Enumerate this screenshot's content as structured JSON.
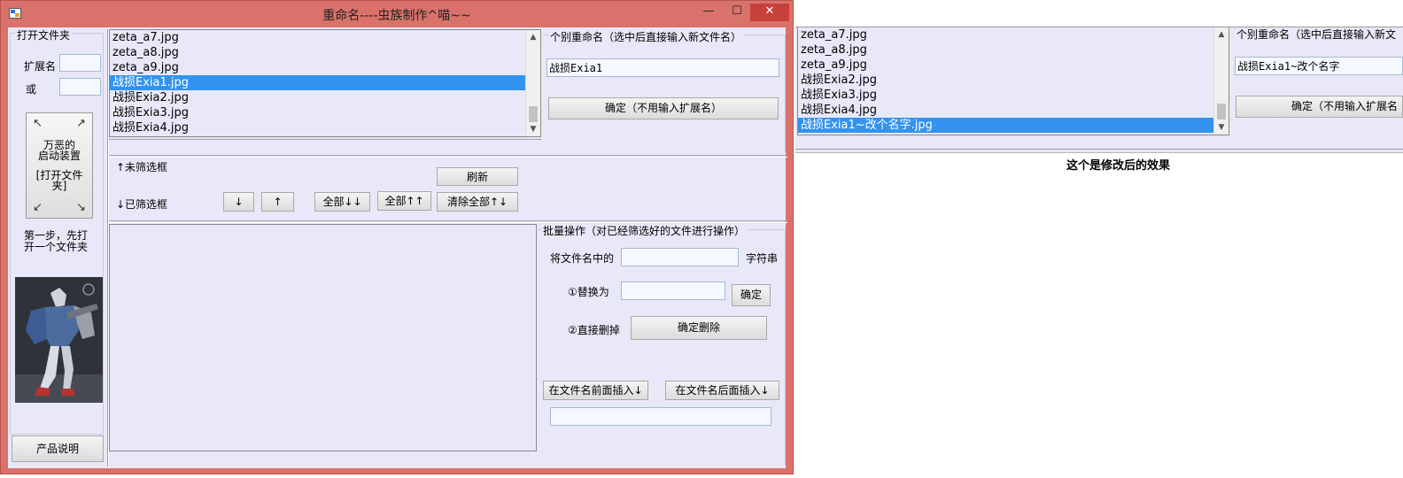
{
  "window": {
    "title": "重命名----虫族制作^喵~~",
    "min_glyph": "—",
    "max_glyph": "☐",
    "close_glyph": "✕"
  },
  "left": {
    "open_folder_label": "打开文件夹",
    "ext_label": "扩展名",
    "or_label": "或",
    "start_device_line1": "万恶的",
    "start_device_line2": "启动装置",
    "start_device_line3": "[打开文件",
    "start_device_line4": "夹]",
    "step_hint_line1": "第一步，先打",
    "step_hint_line2": "开一个文件夹",
    "product_button": "产品说明"
  },
  "files": {
    "items": [
      "zeta_a7.jpg",
      "zeta_a8.jpg",
      "zeta_a9.jpg",
      "战损Exia1.jpg",
      "战损Exia2.jpg",
      "战损Exia3.jpg",
      "战损Exia4.jpg"
    ],
    "selected_index": 3
  },
  "rename": {
    "title": "个别重命名（选中后直接输入新文件名）",
    "input_value": "战损Exia1",
    "confirm_button": "确定（不用输入扩展名）"
  },
  "filter": {
    "unfiltered_label": "↑未筛选框",
    "filtered_label": "↓已筛选框",
    "refresh_button": "刷新",
    "down_button": "↓",
    "up_button": "↑",
    "all_down_button": "全部↓↓",
    "all_up_button": "全部↑↑",
    "clear_all_button": "清除全部↑↓"
  },
  "batch": {
    "title": "批量操作（对已经筛选好的文件进行操作）",
    "in_name_label": "将文件名中的",
    "string_label": "字符串",
    "replace_label": "①替换为",
    "confirm_button": "确定",
    "delete_label": "②直接删掉",
    "confirm_delete_button": "确定删除",
    "insert_front_button": "在文件名前面插入↓",
    "insert_back_button": "在文件名后面插入↓"
  },
  "after": {
    "items": [
      "zeta_a7.jpg",
      "zeta_a8.jpg",
      "zeta_a9.jpg",
      "战损Exia2.jpg",
      "战损Exia3.jpg",
      "战损Exia4.jpg",
      "战损Exia1~改个名字.jpg"
    ],
    "selected_index": 6,
    "rename_title": "个别重命名（选中后直接输入新文",
    "rename_input_value": "战损Exia1~改个名字",
    "confirm_button": "确定（不用输入扩展名",
    "caption": "这个是修改后的效果"
  },
  "colors": {
    "titlebar": "#d9726a",
    "selection": "#3393ee",
    "panel": "#e8e8f8"
  }
}
